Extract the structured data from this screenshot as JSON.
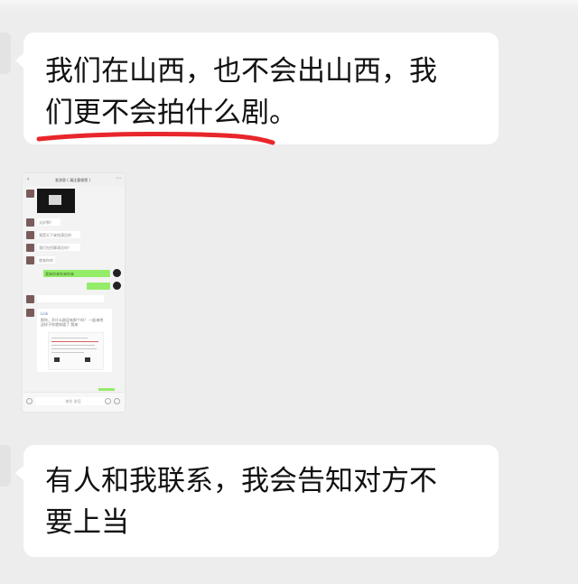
{
  "messages": [
    {
      "text": "我们在山西，也不会出山西，我们更不会拍什么剧。",
      "line1": "我们在山西，也不会出山西，我",
      "line2": "们更不会拍什么剧。"
    },
    {
      "text": "有人和我联系，我会告知对方不要上当",
      "line1": "有人和我联系，我会告知对方不",
      "line2": "要上当"
    }
  ],
  "colors": {
    "background": "#ededed",
    "bubble": "#ffffff",
    "underline": "#e8262b",
    "sent_bubble": "#95ec69"
  },
  "embedded_screenshot": {
    "header_title": "发消息 ( 请注意保密 )",
    "messages": [
      "太好啊？",
      "我是天下来找演员的",
      "我们在招募演员吗？",
      "就来你的",
      "我来你来你来你来"
    ],
    "link_card": {
      "title": "Link",
      "text": "那你，开什么剧没有那个吗？ 一起来吧 这样子你就知道了 我来"
    },
    "input_placeholder": "按住 说话",
    "icons": [
      "back-arrow-icon",
      "more-icon",
      "voice-icon",
      "emoji-icon",
      "plus-icon"
    ]
  }
}
